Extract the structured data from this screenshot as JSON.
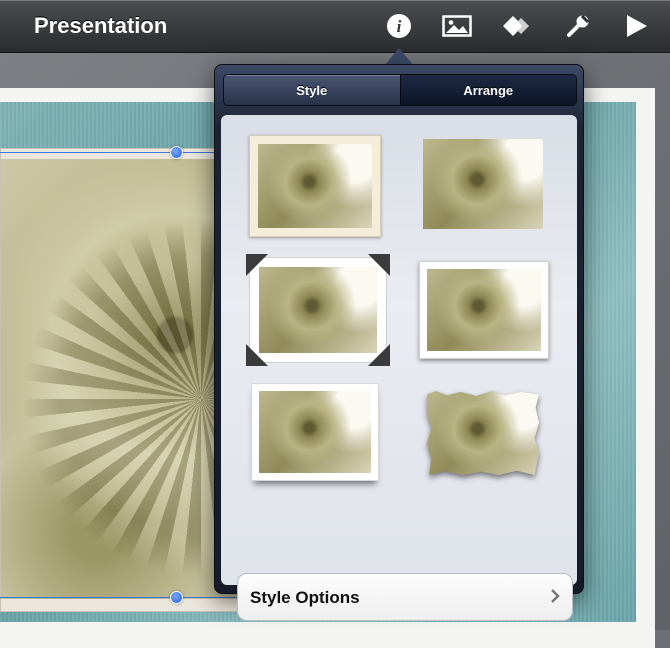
{
  "toolbar": {
    "title": "Presentation",
    "buttons": [
      {
        "name": "info-icon",
        "label": "i"
      },
      {
        "name": "media-icon"
      },
      {
        "name": "animation-icon"
      },
      {
        "name": "tools-icon"
      },
      {
        "name": "play-icon"
      }
    ]
  },
  "popover": {
    "tabs": [
      {
        "label": "Style",
        "active": true
      },
      {
        "label": "Arrange",
        "active": false
      }
    ],
    "styles": [
      {
        "name": "style-cream-border"
      },
      {
        "name": "style-plain"
      },
      {
        "name": "style-photo-corners"
      },
      {
        "name": "style-white-border-shadow"
      },
      {
        "name": "style-curled-shadow"
      },
      {
        "name": "style-torn-edge"
      }
    ],
    "options_label": "Style Options"
  },
  "colors": {
    "toolbar": "#2b2c2e",
    "popover": "#1c2434",
    "selection": "#3a78e0",
    "slide_bg": "#6aa5aa"
  }
}
